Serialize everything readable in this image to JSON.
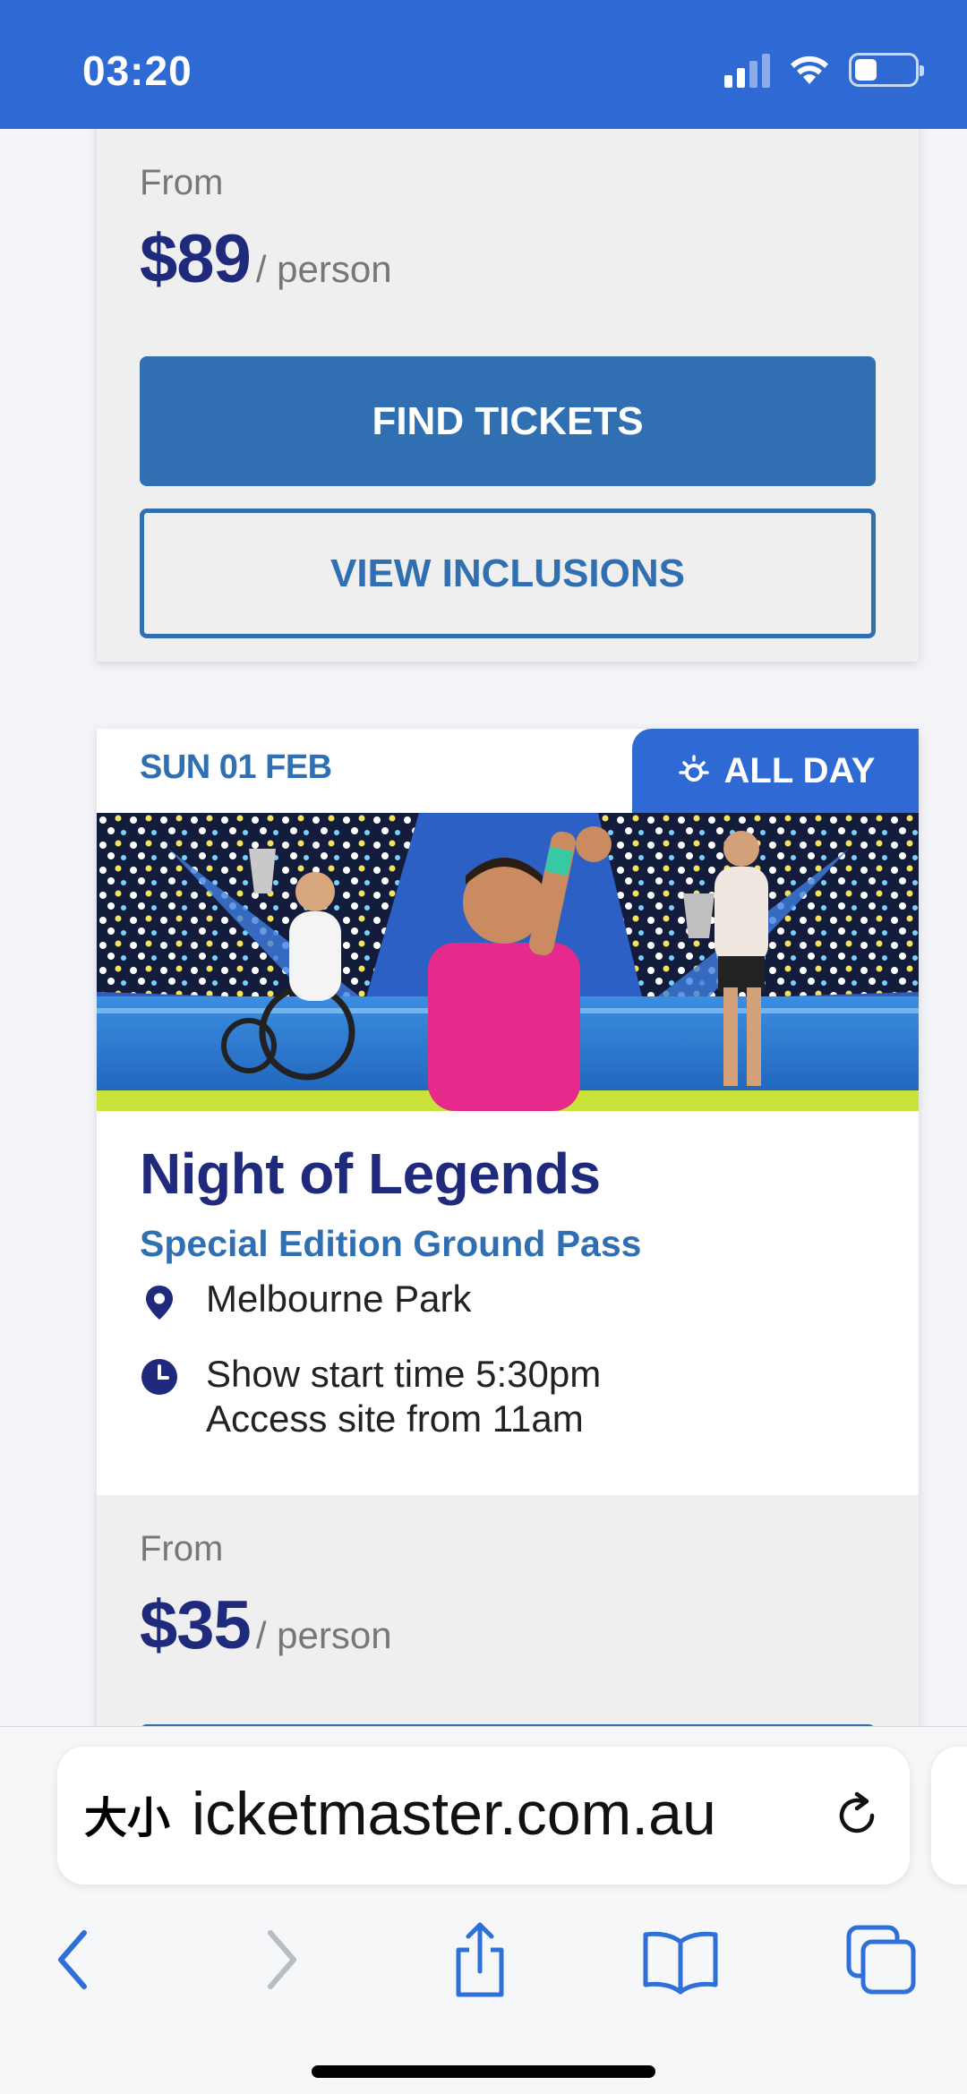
{
  "status_bar": {
    "time": "03:20",
    "battery_level": 0.38,
    "colors": {
      "background": "#2f69d4"
    }
  },
  "top_card": {
    "from_label": "From",
    "price": "$89",
    "per_unit": "/ person",
    "find_tickets_label": "FIND TICKETS",
    "view_inclusions_label": "VIEW INCLUSIONS"
  },
  "event_card": {
    "date": "SUN 01 FEB",
    "badge": {
      "icon": "sun-icon",
      "label": "ALL DAY"
    },
    "hero_image": "tennis-legends-banner",
    "title": "Night of Legends",
    "subtitle": "Special Edition Ground Pass",
    "location": {
      "icon": "map-pin-icon",
      "text": "Melbourne Park"
    },
    "time_info": {
      "icon": "clock-icon",
      "line1": "Show start time 5:30pm",
      "line2": "Access site from 11am"
    },
    "from_label": "From",
    "price": "$35",
    "per_unit": "/ person"
  },
  "browser": {
    "text_size_button": "大小",
    "url": "icketmaster.com.au",
    "reload_icon": "reload-icon",
    "toolbar": [
      "back-icon",
      "forward-icon",
      "share-icon",
      "bookmarks-icon",
      "tabs-icon"
    ]
  },
  "colors": {
    "brand_blue": "#2f6fb2",
    "navy": "#1f2a7c",
    "header_blue": "#2f69d4"
  }
}
